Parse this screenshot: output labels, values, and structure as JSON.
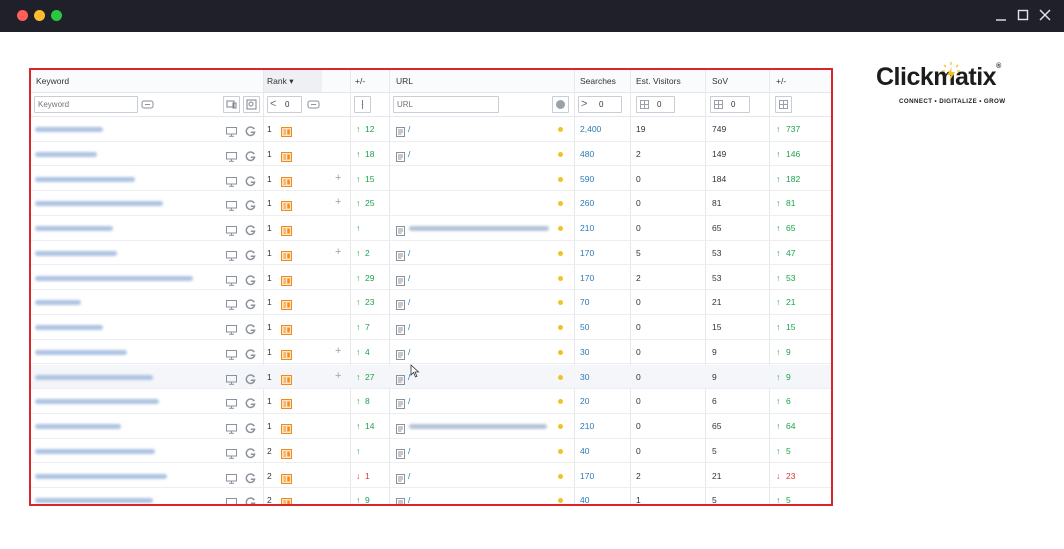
{
  "window": {
    "controls": [
      "minimize-icon",
      "maximize-icon",
      "close-icon"
    ]
  },
  "logo": {
    "main_a": "Click",
    "main_b": "matix",
    "registered": "®",
    "tagline": "CONNECT • DIGITALIZE • GROW"
  },
  "table": {
    "headers": {
      "keyword": "Keyword",
      "rank": "Rank ▾",
      "change": "+/-",
      "url": "URL",
      "searches": "Searches",
      "visitors": "Est. Visitors",
      "sov": "SoV",
      "sov_change": "+/-"
    },
    "filters": {
      "keyword_placeholder": "Keyword",
      "rank_operator": "<",
      "rank_value": "0",
      "url_placeholder": "URL",
      "searches_operator": ">",
      "searches_value": "0",
      "visitors_value": "0",
      "sov_value": "0"
    },
    "rows": [
      {
        "rank": "1",
        "change": "12",
        "dir": "up",
        "plus": false,
        "url": "/",
        "url_blur": false,
        "url_icon": true,
        "searches": "2,400",
        "visitors": "19",
        "sov": "749",
        "sov_change": "737",
        "sov_dir": "up"
      },
      {
        "rank": "1",
        "change": "18",
        "dir": "up",
        "plus": false,
        "url": "/",
        "url_blur": false,
        "url_icon": true,
        "searches": "480",
        "visitors": "2",
        "sov": "149",
        "sov_change": "146",
        "sov_dir": "up"
      },
      {
        "rank": "1",
        "change": "15",
        "dir": "up",
        "plus": true,
        "url": "",
        "url_blur": false,
        "url_icon": false,
        "searches": "590",
        "visitors": "0",
        "sov": "184",
        "sov_change": "182",
        "sov_dir": "up"
      },
      {
        "rank": "1",
        "change": "25",
        "dir": "up",
        "plus": true,
        "url": "",
        "url_blur": false,
        "url_icon": false,
        "searches": "260",
        "visitors": "0",
        "sov": "81",
        "sov_change": "81",
        "sov_dir": "up"
      },
      {
        "rank": "1",
        "change": "",
        "dir": "up",
        "plus": false,
        "url": "",
        "url_blur": true,
        "url_icon": true,
        "searches": "210",
        "visitors": "0",
        "sov": "65",
        "sov_change": "65",
        "sov_dir": "up"
      },
      {
        "rank": "1",
        "change": "2",
        "dir": "up",
        "plus": true,
        "url": "/",
        "url_blur": false,
        "url_icon": true,
        "searches": "170",
        "visitors": "5",
        "sov": "53",
        "sov_change": "47",
        "sov_dir": "up"
      },
      {
        "rank": "1",
        "change": "29",
        "dir": "up",
        "plus": false,
        "url": "/",
        "url_blur": false,
        "url_icon": true,
        "searches": "170",
        "visitors": "2",
        "sov": "53",
        "sov_change": "53",
        "sov_dir": "up"
      },
      {
        "rank": "1",
        "change": "23",
        "dir": "up",
        "plus": false,
        "url": "/",
        "url_blur": false,
        "url_icon": true,
        "searches": "70",
        "visitors": "0",
        "sov": "21",
        "sov_change": "21",
        "sov_dir": "up"
      },
      {
        "rank": "1",
        "change": "7",
        "dir": "up",
        "plus": false,
        "url": "/",
        "url_blur": false,
        "url_icon": true,
        "searches": "50",
        "visitors": "0",
        "sov": "15",
        "sov_change": "15",
        "sov_dir": "up"
      },
      {
        "rank": "1",
        "change": "4",
        "dir": "up",
        "plus": true,
        "url": "/",
        "url_blur": false,
        "url_icon": true,
        "searches": "30",
        "visitors": "0",
        "sov": "9",
        "sov_change": "9",
        "sov_dir": "up"
      },
      {
        "rank": "1",
        "change": "27",
        "dir": "up",
        "plus": true,
        "url": "/",
        "url_blur": false,
        "url_icon": true,
        "searches": "30",
        "visitors": "0",
        "sov": "9",
        "sov_change": "9",
        "sov_dir": "up",
        "highlight": true
      },
      {
        "rank": "1",
        "change": "8",
        "dir": "up",
        "plus": false,
        "url": "/",
        "url_blur": false,
        "url_icon": true,
        "searches": "20",
        "visitors": "0",
        "sov": "6",
        "sov_change": "6",
        "sov_dir": "up"
      },
      {
        "rank": "1",
        "change": "14",
        "dir": "up",
        "plus": false,
        "url": "",
        "url_blur": true,
        "url_icon": true,
        "searches": "210",
        "visitors": "0",
        "sov": "65",
        "sov_change": "64",
        "sov_dir": "up"
      },
      {
        "rank": "2",
        "change": "",
        "dir": "up",
        "plus": false,
        "url": "/",
        "url_blur": false,
        "url_icon": true,
        "searches": "40",
        "visitors": "0",
        "sov": "5",
        "sov_change": "5",
        "sov_dir": "up"
      },
      {
        "rank": "2",
        "change": "1",
        "dir": "down",
        "plus": false,
        "url": "/",
        "url_blur": false,
        "url_icon": true,
        "searches": "170",
        "visitors": "2",
        "sov": "21",
        "sov_change": "23",
        "sov_dir": "down"
      },
      {
        "rank": "2",
        "change": "9",
        "dir": "up",
        "plus": false,
        "url": "/",
        "url_blur": false,
        "url_icon": true,
        "searches": "40",
        "visitors": "1",
        "sov": "5",
        "sov_change": "5",
        "sov_dir": "up"
      }
    ],
    "colors": {
      "up": "#1aa34a",
      "down": "#e03131",
      "link": "#2a7ab8",
      "dot": "#f3c222",
      "border": "#d9262c"
    }
  }
}
